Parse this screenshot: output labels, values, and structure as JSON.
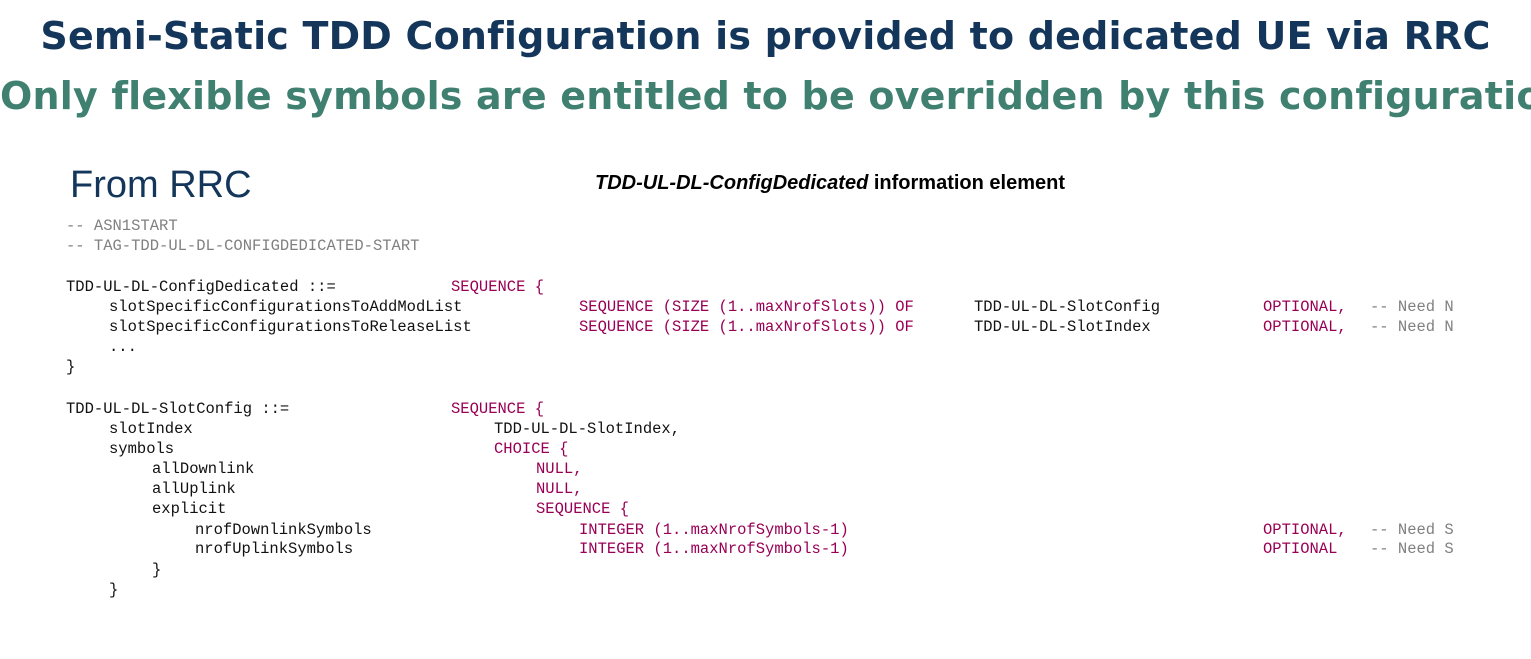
{
  "title_line1": "Semi-Static TDD Configuration is provided to dedicated UE via RRC",
  "title_line2": "Only flexible symbols are entitled to be overridden by this configuration",
  "from_label": "From RRC",
  "ie_title_italic": "TDD-UL-DL-ConfigDedicated",
  "ie_title_rest": " information element",
  "code": {
    "c1": "-- ASN1START",
    "c2": "-- TAG-TDD-UL-DL-CONFIGDEDICATED-START",
    "d_name": "TDD-UL-DL-ConfigDedicated ::=",
    "d_seq": "SEQUENCE {",
    "l1_name": "slotSpecificConfigurationsToAddModList",
    "l1_kw": "SEQUENCE (SIZE (1..maxNrofSlots)) OF",
    "l1_type": "TDD-UL-DL-SlotConfig",
    "l1_opt": "OPTIONAL,",
    "l1_need": "-- Need N",
    "l2_name": "slotSpecificConfigurationsToReleaseList",
    "l2_kw": "SEQUENCE (SIZE (1..maxNrofSlots)) OF",
    "l2_type": "TDD-UL-DL-SlotIndex",
    "l2_opt": "OPTIONAL,",
    "l2_need": "-- Need N",
    "ellipsis": "...",
    "close1": "}",
    "s_name": "TDD-UL-DL-SlotConfig ::=",
    "s_seq": "SEQUENCE {",
    "slotIndex": "slotIndex",
    "slotIndex_type": "TDD-UL-DL-SlotIndex,",
    "symbols": "symbols",
    "choice": "CHOICE {",
    "allDownlink": "allDownlink",
    "null1": "NULL,",
    "allUplink": "allUplink",
    "null2": "NULL,",
    "explicit": "explicit",
    "seq3": "SEQUENCE {",
    "nrofDl": "nrofDownlinkSymbols",
    "nrofDl_type": "INTEGER (1..maxNrofSymbols-1)",
    "nrofDl_opt": "OPTIONAL,",
    "nrofDl_need": "-- Need S",
    "nrofUl": "nrofUplinkSymbols",
    "nrofUl_type": "INTEGER (1..maxNrofSymbols-1)",
    "nrofUl_opt": "OPTIONAL",
    "nrofUl_need": "-- Need S",
    "close2": "}",
    "close3": "}"
  }
}
